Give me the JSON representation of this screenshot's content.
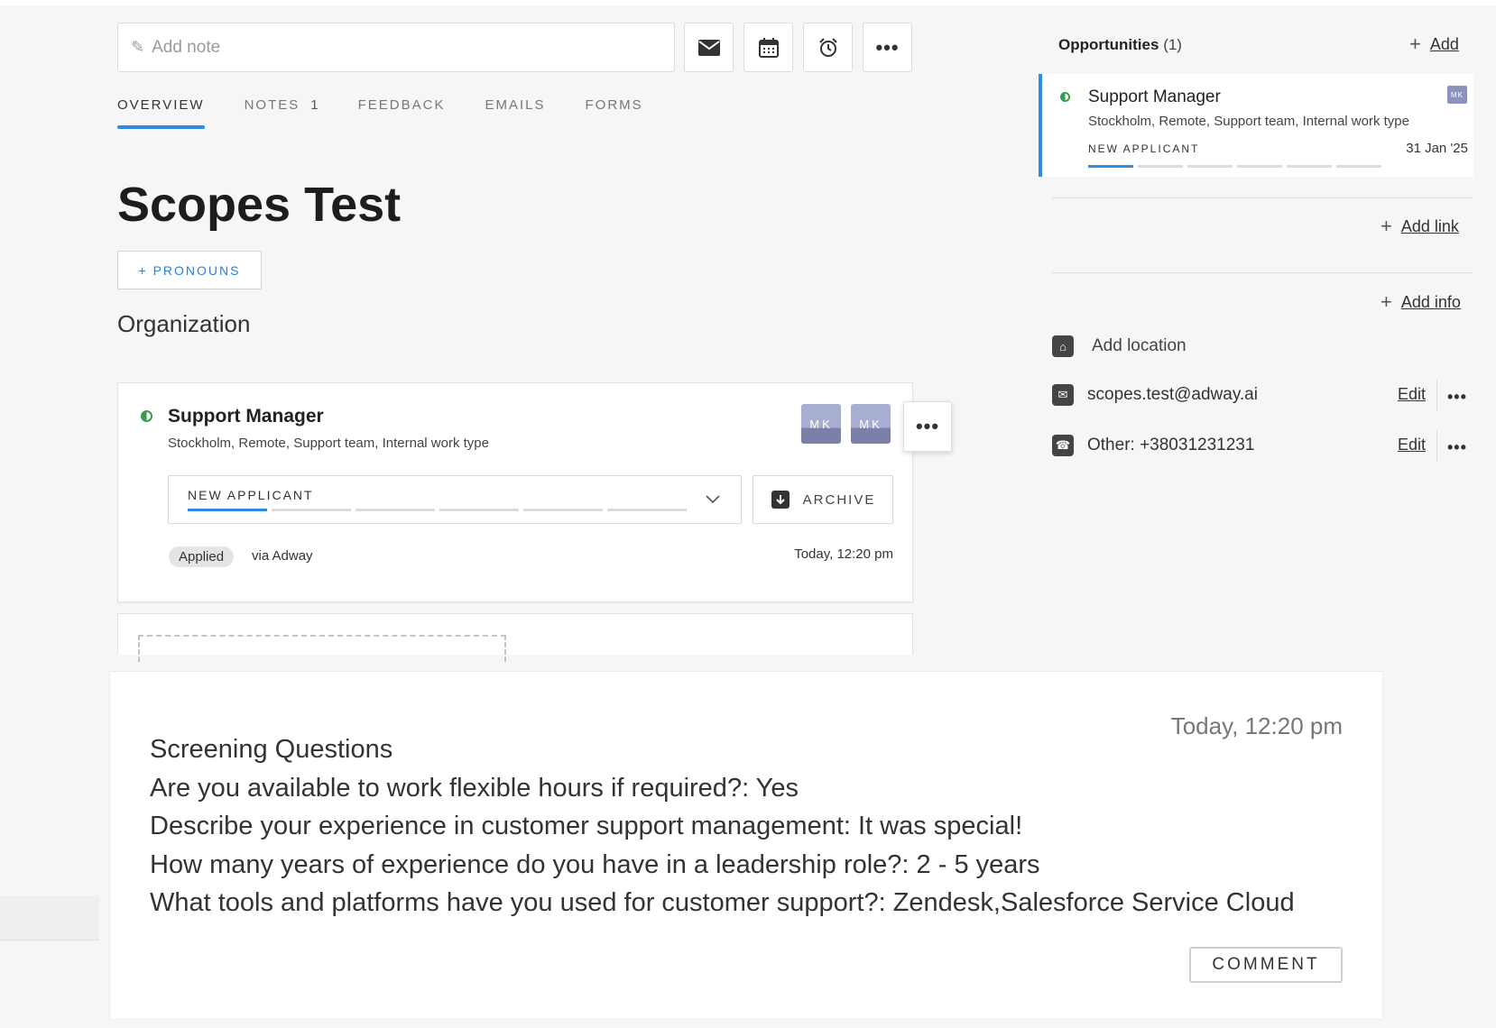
{
  "note": {
    "placeholder": "Add note"
  },
  "toolbar": {
    "more_label": "•••"
  },
  "tabs": [
    {
      "label": "OVERVIEW",
      "active": true
    },
    {
      "label": "NOTES",
      "count": "1"
    },
    {
      "label": "FEEDBACK"
    },
    {
      "label": "EMAILS"
    },
    {
      "label": "FORMS"
    }
  ],
  "candidate": {
    "name": "Scopes Test",
    "pronouns_label": "+ PRONOUNS",
    "organization": "Organization"
  },
  "application": {
    "title": "Support Manager",
    "subtitle": "Stockholm, Remote, Support team, Internal work type",
    "avatars": [
      "MK",
      "MK"
    ],
    "stage": "NEW APPLICANT",
    "archive_label": "ARCHIVE",
    "badge": "Applied",
    "source": "via Adway",
    "time": "Today, 12:20 pm",
    "status_color": "#3d9a4c",
    "accent_color": "#2d8ce8"
  },
  "opportunities": {
    "title": "Opportunities",
    "count": "(1)",
    "add_label": "Add",
    "item": {
      "name": "Support Manager",
      "subtitle": "Stockholm, Remote, Support team, Internal work type",
      "stage": "NEW APPLICANT",
      "date": "31 Jan '25",
      "avatar": "MK"
    }
  },
  "sidebar": {
    "add_link_label": "Add link",
    "add_info_label": "Add info",
    "location_label": "Add location",
    "email": "scopes.test@adway.ai",
    "phone": "Other: +38031231231",
    "edit_label": "Edit"
  },
  "screening": {
    "time": "Today, 12:20 pm",
    "lines": [
      "Screening Questions",
      "Are you available to work flexible hours if required?: Yes",
      "Describe your experience in customer support management: It was special!",
      "How many years of experience do you have in a leadership role?: 2 - 5 years",
      "What tools and platforms have you used for customer support?: Zendesk,Salesforce Service Cloud"
    ],
    "comment_label": "COMMENT"
  }
}
